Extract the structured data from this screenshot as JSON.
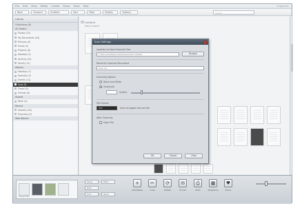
{
  "window": {
    "title": "Organizer",
    "menu": [
      "File",
      "Edit",
      "View",
      "Media",
      "Create",
      "Share",
      "Tools",
      "Help"
    ]
  },
  "toolbar": {
    "buttons": [
      "Back",
      "Forward",
      "Untitled",
      "Sort",
      "Filter",
      "Details",
      "Options"
    ],
    "search_placeholder": "Search"
  },
  "sidebar": {
    "header": "Library",
    "items": [
      {
        "label": "Collections (6)",
        "type": "section"
      },
      {
        "label": "All Folders",
        "type": "section"
      },
      {
        "label": "Photos (12)",
        "type": "item"
      },
      {
        "label": "My Documents (24)",
        "type": "item"
      },
      {
        "label": "Pictures (9)",
        "type": "item"
      },
      {
        "label": "Scans (4)",
        "type": "item"
      },
      {
        "label": "Projects (8)",
        "type": "item"
      },
      {
        "label": "Desktop (2)",
        "type": "item"
      },
      {
        "label": "Archive (15)",
        "type": "item"
      },
      {
        "label": "Family (21)",
        "type": "item"
      },
      {
        "label": "Albums",
        "type": "section"
      },
      {
        "label": "Holidays (7)",
        "type": "item"
      },
      {
        "label": "Portraits (3)",
        "type": "item"
      },
      {
        "label": "Events (11)",
        "type": "item"
      },
      {
        "label": "Scan 01",
        "type": "selected"
      },
      {
        "label": "Travel (5)",
        "type": "item"
      },
      {
        "label": "Friends (6)",
        "type": "item"
      },
      {
        "label": "Shared",
        "type": "section"
      },
      {
        "label": "Work (4)",
        "type": "item"
      },
      {
        "label": "Recent",
        "type": "section"
      },
      {
        "label": "Imports (18)",
        "type": "item"
      },
      {
        "label": "Favorites (9)",
        "type": "item"
      },
      {
        "label": "Web Albums",
        "type": "section"
      }
    ]
  },
  "main": {
    "folder_title": "Untitled",
    "folder_sub": "Date created"
  },
  "dialog": {
    "title": "Scan Settings",
    "location_label": "Location to Save Scanned Files",
    "location_value": "C:\\Documents\\Scans\\Scanned Documents",
    "browse_label": "Browse",
    "name_label": "Name for Scanned Document",
    "name_value": "Scan 01",
    "options_label": "Scanning Options",
    "radio_1": "Black and White",
    "radio_2": "Grayscale",
    "slider_label": "Quality",
    "format_label": "File Format",
    "format_value": "PDF",
    "format_note": "Save all pages into one file",
    "after_label": "After Scanning",
    "after_check": "Open File",
    "ok_label": "OK",
    "cancel_label": "Cancel",
    "help_label": "Help"
  },
  "dock": {
    "tray_label": "Project Bin",
    "small_buttons": [
      "Show",
      "Hide",
      "Sort",
      "Filter",
      "Open"
    ],
    "actions": [
      {
        "icon": "+",
        "label": "Add Media"
      },
      {
        "icon": "✂",
        "label": "Crop"
      },
      {
        "icon": "⟳",
        "label": "Rotate"
      },
      {
        "icon": "✉",
        "label": "E-mail"
      },
      {
        "icon": "⎙",
        "label": "Print"
      },
      {
        "icon": "▦",
        "label": "Slideshow"
      },
      {
        "icon": "♥",
        "label": "Share"
      }
    ],
    "zoom_level": 0.35
  }
}
